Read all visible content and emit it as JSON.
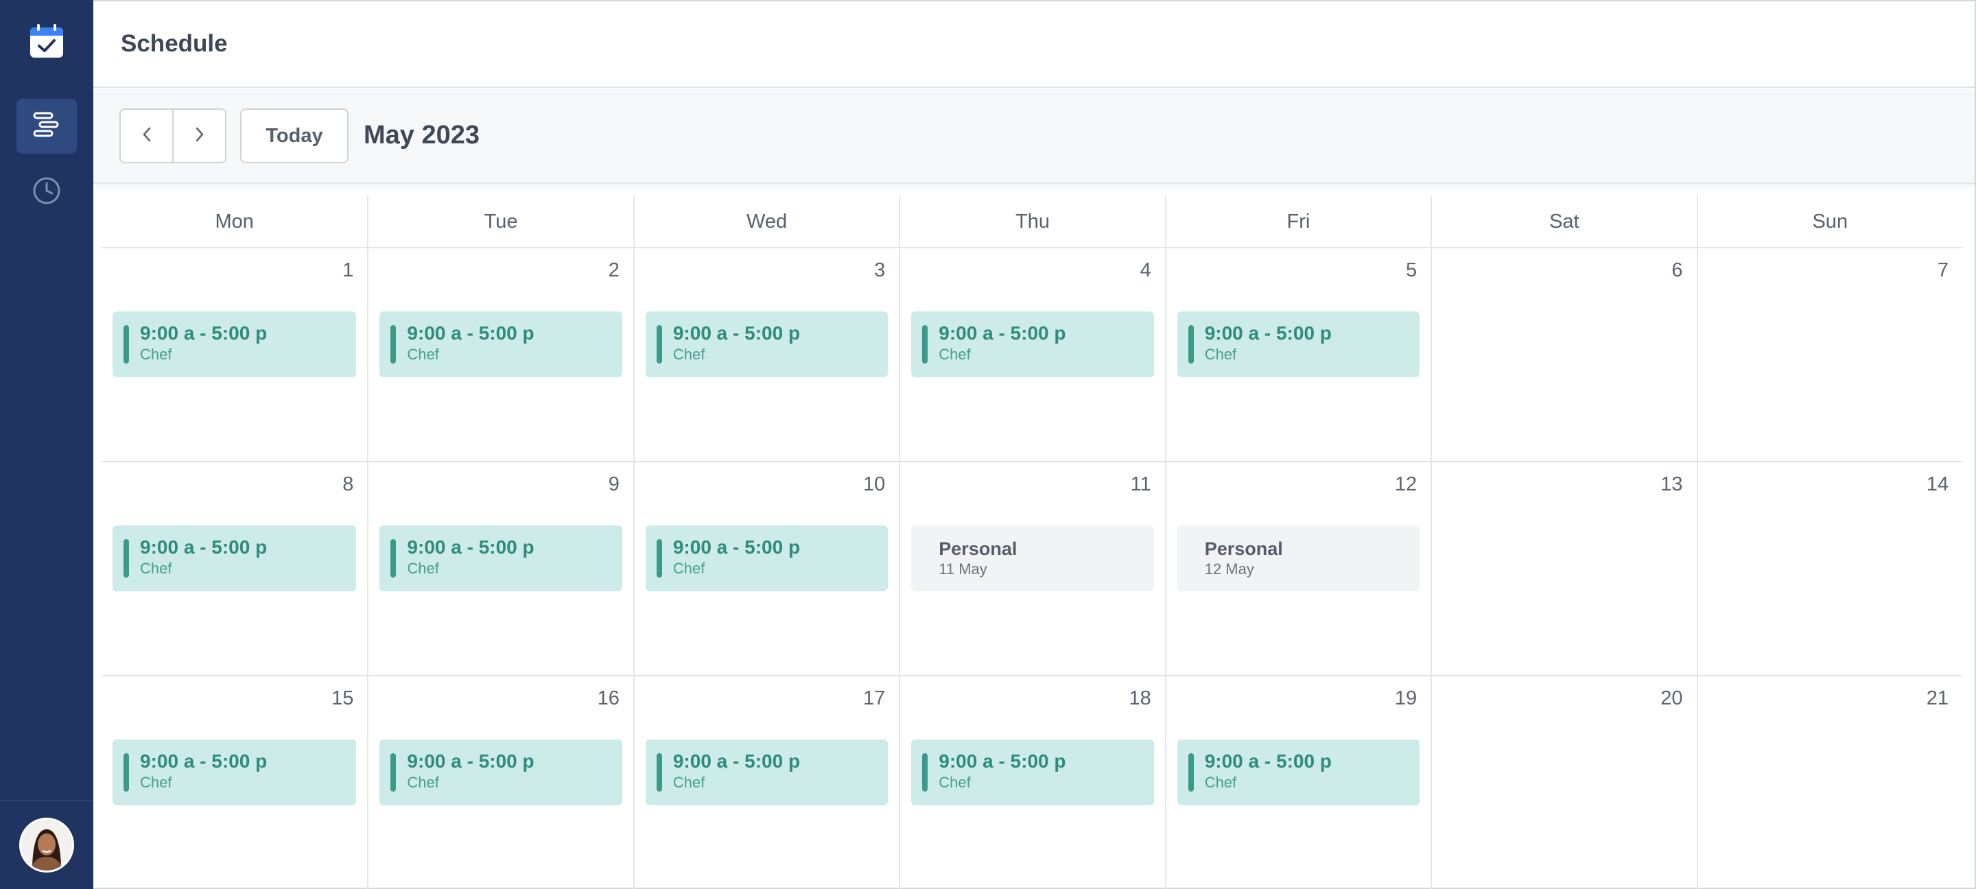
{
  "app": {
    "title": "Schedule"
  },
  "sidebar": {
    "icons": [
      "calendar-check-icon",
      "timeline-icon",
      "clock-icon"
    ],
    "colors": {
      "bg": "#1f3461",
      "active": "#2e4a80",
      "accent": "#3b82f6"
    }
  },
  "toolbar": {
    "prev_icon": "chevron-left-icon",
    "next_icon": "chevron-right-icon",
    "today_label": "Today",
    "month_label": "May 2023"
  },
  "calendar": {
    "weekdays": [
      "Mon",
      "Tue",
      "Wed",
      "Thu",
      "Fri",
      "Sat",
      "Sun"
    ],
    "weeks": [
      [
        {
          "day": "1",
          "event": {
            "type": "shift",
            "time": "9:00 a - 5:00 p",
            "role": "Chef"
          }
        },
        {
          "day": "2",
          "event": {
            "type": "shift",
            "time": "9:00 a - 5:00 p",
            "role": "Chef"
          }
        },
        {
          "day": "3",
          "event": {
            "type": "shift",
            "time": "9:00 a - 5:00 p",
            "role": "Chef"
          }
        },
        {
          "day": "4",
          "event": {
            "type": "shift",
            "time": "9:00 a - 5:00 p",
            "role": "Chef"
          }
        },
        {
          "day": "5",
          "event": {
            "type": "shift",
            "time": "9:00 a - 5:00 p",
            "role": "Chef"
          }
        },
        {
          "day": "6",
          "event": null
        },
        {
          "day": "7",
          "event": null
        }
      ],
      [
        {
          "day": "8",
          "event": {
            "type": "shift",
            "time": "9:00 a - 5:00 p",
            "role": "Chef"
          }
        },
        {
          "day": "9",
          "event": {
            "type": "shift",
            "time": "9:00 a - 5:00 p",
            "role": "Chef"
          }
        },
        {
          "day": "10",
          "event": {
            "type": "shift",
            "time": "9:00 a - 5:00 p",
            "role": "Chef"
          }
        },
        {
          "day": "11",
          "event": {
            "type": "personal",
            "title": "Personal",
            "date": "11 May"
          }
        },
        {
          "day": "12",
          "event": {
            "type": "personal",
            "title": "Personal",
            "date": "12 May"
          }
        },
        {
          "day": "13",
          "event": null
        },
        {
          "day": "14",
          "event": null
        }
      ],
      [
        {
          "day": "15",
          "event": {
            "type": "shift",
            "time": "9:00 a - 5:00 p",
            "role": "Chef"
          }
        },
        {
          "day": "16",
          "event": {
            "type": "shift",
            "time": "9:00 a - 5:00 p",
            "role": "Chef"
          }
        },
        {
          "day": "17",
          "event": {
            "type": "shift",
            "time": "9:00 a - 5:00 p",
            "role": "Chef"
          }
        },
        {
          "day": "18",
          "event": {
            "type": "shift",
            "time": "9:00 a - 5:00 p",
            "role": "Chef"
          }
        },
        {
          "day": "19",
          "event": {
            "type": "shift",
            "time": "9:00 a - 5:00 p",
            "role": "Chef"
          }
        },
        {
          "day": "20",
          "event": null
        },
        {
          "day": "21",
          "event": null
        }
      ]
    ],
    "colors": {
      "shift_bg": "#cdebe8",
      "shift_text": "#2f8c7c",
      "personal_bg": "#f2f3f4"
    }
  }
}
